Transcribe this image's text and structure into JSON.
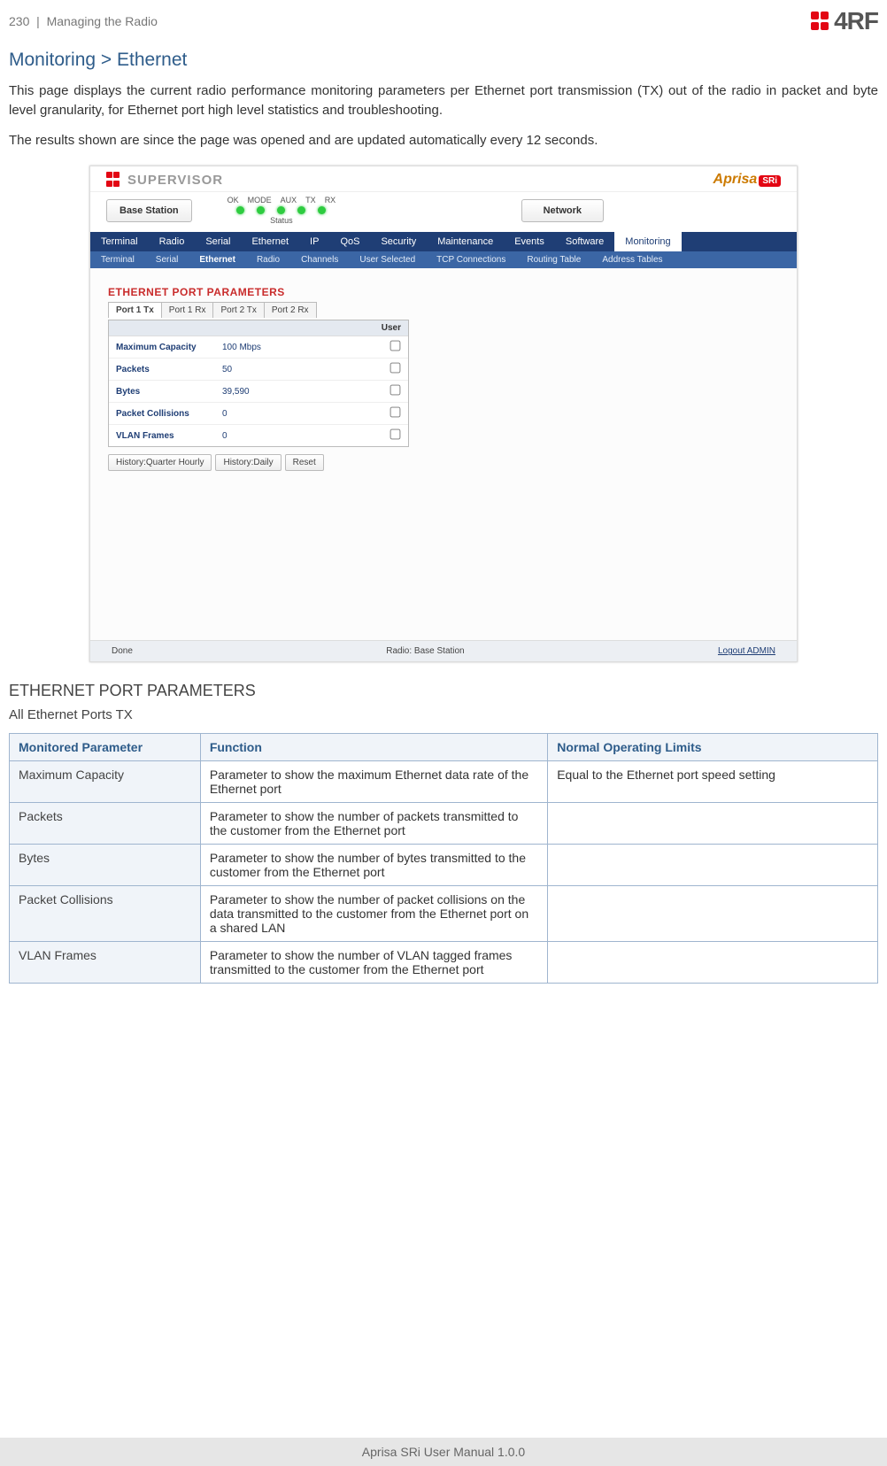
{
  "header": {
    "page_num": "230",
    "sep": "|",
    "section": "Managing the Radio",
    "brand": "4RF"
  },
  "title": "Monitoring > Ethernet",
  "para1": "This page displays the current radio performance monitoring parameters per Ethernet port transmission (TX) out of the radio in packet and byte level granularity, for Ethernet port high level statistics and troubleshooting.",
  "para2": "The results shown are since the page was opened and are updated automatically every 12 seconds.",
  "shot": {
    "supervisor": "SUPERVISOR",
    "aprisa": "Aprisa",
    "aprisa_sr": "SRi",
    "base_station_btn": "Base Station",
    "network_btn": "Network",
    "leds": {
      "labels": [
        "OK",
        "MODE",
        "AUX",
        "TX",
        "RX"
      ],
      "status": "Status"
    },
    "menu1": [
      "Terminal",
      "Radio",
      "Serial",
      "Ethernet",
      "IP",
      "QoS",
      "Security",
      "Maintenance",
      "Events",
      "Software",
      "Monitoring"
    ],
    "menu1_active": "Monitoring",
    "menu2": [
      "Terminal",
      "Serial",
      "Ethernet",
      "Radio",
      "Channels",
      "User Selected",
      "TCP Connections",
      "Routing Table",
      "Address Tables"
    ],
    "menu2_active": "Ethernet",
    "panel_title": "ETHERNET PORT PARAMETERS",
    "port_tabs": [
      "Port 1 Tx",
      "Port 1 Rx",
      "Port 2 Tx",
      "Port 2 Rx"
    ],
    "port_tabs_active": "Port 1 Tx",
    "col_hdr": "User",
    "rows": [
      {
        "lbl": "Maximum Capacity",
        "val": "100 Mbps"
      },
      {
        "lbl": "Packets",
        "val": "50"
      },
      {
        "lbl": "Bytes",
        "val": "39,590"
      },
      {
        "lbl": "Packet Collisions",
        "val": "0"
      },
      {
        "lbl": "VLAN Frames",
        "val": "0"
      }
    ],
    "hist_btns": [
      "History:Quarter Hourly",
      "History:Daily",
      "Reset"
    ],
    "footer": {
      "left": "Done",
      "mid": "Radio: Base Station",
      "right": "Logout ADMIN"
    }
  },
  "subhead1": "ETHERNET PORT PARAMETERS",
  "subhead2": "All Ethernet Ports TX",
  "table": {
    "headers": [
      "Monitored Parameter",
      "Function",
      "Normal Operating Limits"
    ],
    "rows": [
      {
        "p": "Maximum Capacity",
        "f": "Parameter to show the maximum Ethernet data rate of the Ethernet port",
        "n": "Equal to the Ethernet port speed setting"
      },
      {
        "p": "Packets",
        "f": "Parameter to show the number of packets transmitted to the customer from the Ethernet port",
        "n": ""
      },
      {
        "p": "Bytes",
        "f": "Parameter to show the number of bytes transmitted to the customer from the Ethernet port",
        "n": ""
      },
      {
        "p": "Packet Collisions",
        "f": "Parameter to show the number of packet collisions on the data transmitted to the customer from the Ethernet port on a shared LAN",
        "n": ""
      },
      {
        "p": "VLAN Frames",
        "f": "Parameter to show the number of VLAN tagged frames transmitted to the customer from the Ethernet port",
        "n": ""
      }
    ]
  },
  "footer": "Aprisa SRi User Manual 1.0.0"
}
